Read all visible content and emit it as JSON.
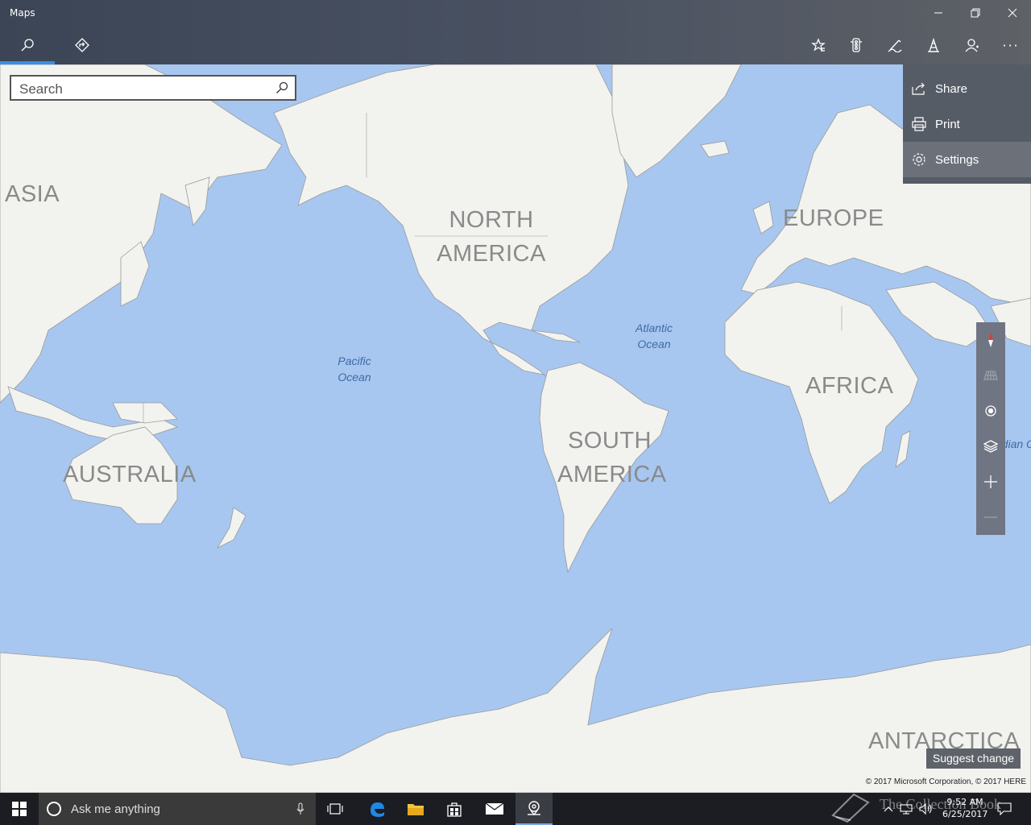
{
  "window": {
    "title": "Maps"
  },
  "toolbar": {
    "left": [
      {
        "name": "search-tab",
        "icon": "search-icon",
        "active": true
      },
      {
        "name": "directions-tab",
        "icon": "directions-icon"
      }
    ],
    "right": [
      {
        "name": "favorites-button",
        "icon": "favorites-icon"
      },
      {
        "name": "traffic-button",
        "icon": "traffic-icon"
      },
      {
        "name": "ink-button",
        "icon": "pen-icon"
      },
      {
        "name": "3d-cities-button",
        "icon": "buildings-icon"
      },
      {
        "name": "account-button",
        "icon": "person-icon"
      },
      {
        "name": "more-button",
        "icon": "more-icon",
        "label": "···"
      }
    ]
  },
  "search": {
    "placeholder": "Search"
  },
  "menu": {
    "items": [
      {
        "label": "Share",
        "icon": "share-icon"
      },
      {
        "label": "Print",
        "icon": "print-icon"
      },
      {
        "label": "Settings",
        "icon": "gear-icon",
        "highlighted": true
      }
    ]
  },
  "map": {
    "continents": {
      "asia": "ASIA",
      "north_america": "NORTH AMERICA",
      "europe": "EUROPE",
      "africa": "AFRICA",
      "south_america": "SOUTH AMERICA",
      "australia": "AUSTRALIA",
      "antarctica": "ANTARCTICA"
    },
    "oceans": {
      "pacific": "Pacific Ocean",
      "atlantic": "Atlantic Ocean",
      "indian": "Indian Ocean"
    },
    "land_color": "#f2f2ef",
    "water_color": "#a7c7f0"
  },
  "map_controls": [
    {
      "name": "compass-button",
      "icon": "compass-icon"
    },
    {
      "name": "tilt-button",
      "icon": "tilt-grid-icon",
      "disabled": true
    },
    {
      "name": "my-location-button",
      "icon": "location-target-icon"
    },
    {
      "name": "map-views-button",
      "icon": "layers-icon"
    },
    {
      "name": "zoom-in-button",
      "icon": "plus-icon"
    },
    {
      "name": "zoom-out-button",
      "icon": "minus-icon",
      "disabled": true
    }
  ],
  "suggest_change": "Suggest change",
  "copyright": "© 2017 Microsoft Corporation, © 2017 HERE",
  "taskbar": {
    "search_placeholder": "Ask me anything",
    "time": "9:52 AM",
    "date": "6/25/2017",
    "watermark": "The Collection Book"
  }
}
